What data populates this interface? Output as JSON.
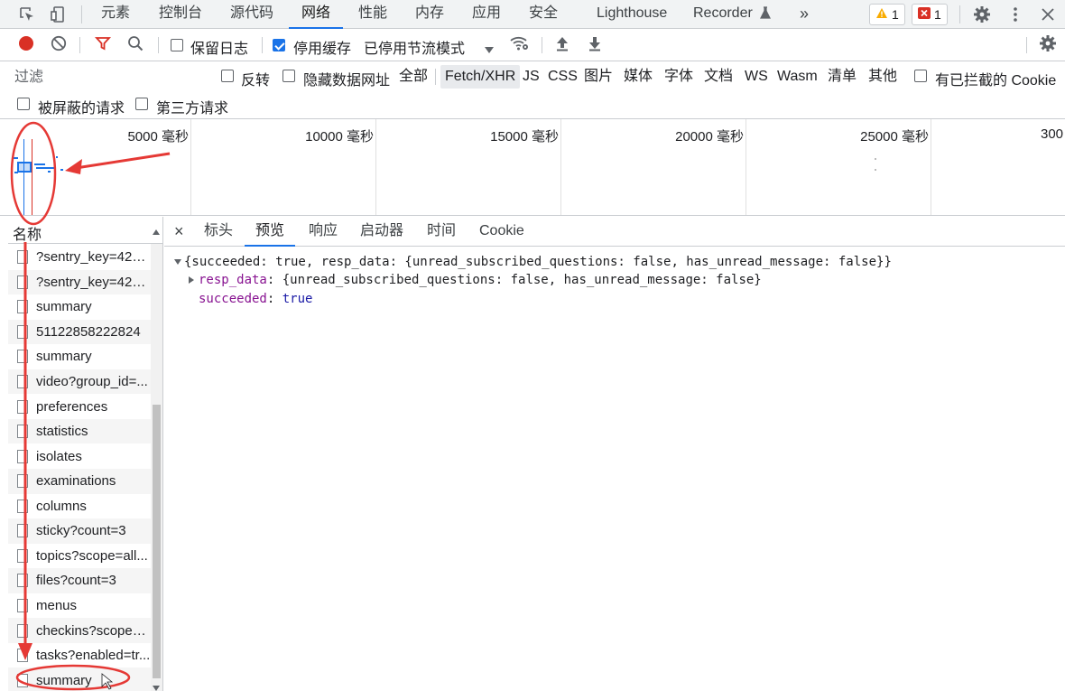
{
  "tabs": {
    "elements": "元素",
    "console": "控制台",
    "sources": "源代码",
    "network": "网络",
    "performance": "性能",
    "memory": "内存",
    "application": "应用",
    "security": "安全",
    "lighthouse": "Lighthouse",
    "recorder": "Recorder",
    "more": "»",
    "warnings_count": "1",
    "errors_count": "1"
  },
  "toolbar": {
    "preserve_log": "保留日志",
    "disable_cache": "停用缓存",
    "throttling": "已停用节流模式"
  },
  "filter": {
    "placeholder": "过滤",
    "invert": "反转",
    "hide_data_urls": "隐藏数据网址",
    "types": [
      "全部",
      "Fetch/XHR",
      "JS",
      "CSS",
      "图片",
      "媒体",
      "字体",
      "文档",
      "WS",
      "Wasm",
      "清单",
      "其他"
    ],
    "blocked_cookies": "有已拦截的 Cookie",
    "blocked_requests": "被屏蔽的请求",
    "third_party": "第三方请求"
  },
  "overview": {
    "ticks": [
      "5000 毫秒",
      "10000 毫秒",
      "15000 毫秒",
      "20000 毫秒",
      "25000 毫秒",
      "300"
    ]
  },
  "request_list": {
    "header": "名称",
    "rows": [
      "?sentry_key=423...",
      "?sentry_key=423...",
      "summary",
      "51122858222824",
      "summary",
      "video?group_id=...",
      "preferences",
      "statistics",
      "isolates",
      "examinations",
      "columns",
      "sticky?count=3",
      "topics?scope=all...",
      "files?count=3",
      "menus",
      "checkins?scope=...",
      "tasks?enabled=tr...",
      "summary"
    ]
  },
  "details": {
    "close": "×",
    "tabs": [
      "标头",
      "预览",
      "响应",
      "启动器",
      "时间",
      "Cookie"
    ],
    "active_tab": "预览",
    "preview": {
      "root": "{succeeded: true, resp_data: {unread_subscribed_questions: false, has_unread_message: false}}",
      "resp_data_key": "resp_data",
      "resp_data_value": "{unread_subscribed_questions: false, has_unread_message: false}",
      "succeeded_key": "succeeded",
      "succeeded_value": "true"
    }
  },
  "colors": {
    "accent": "#1a73e8",
    "record": "#d93025",
    "annotation": "#e53935"
  }
}
